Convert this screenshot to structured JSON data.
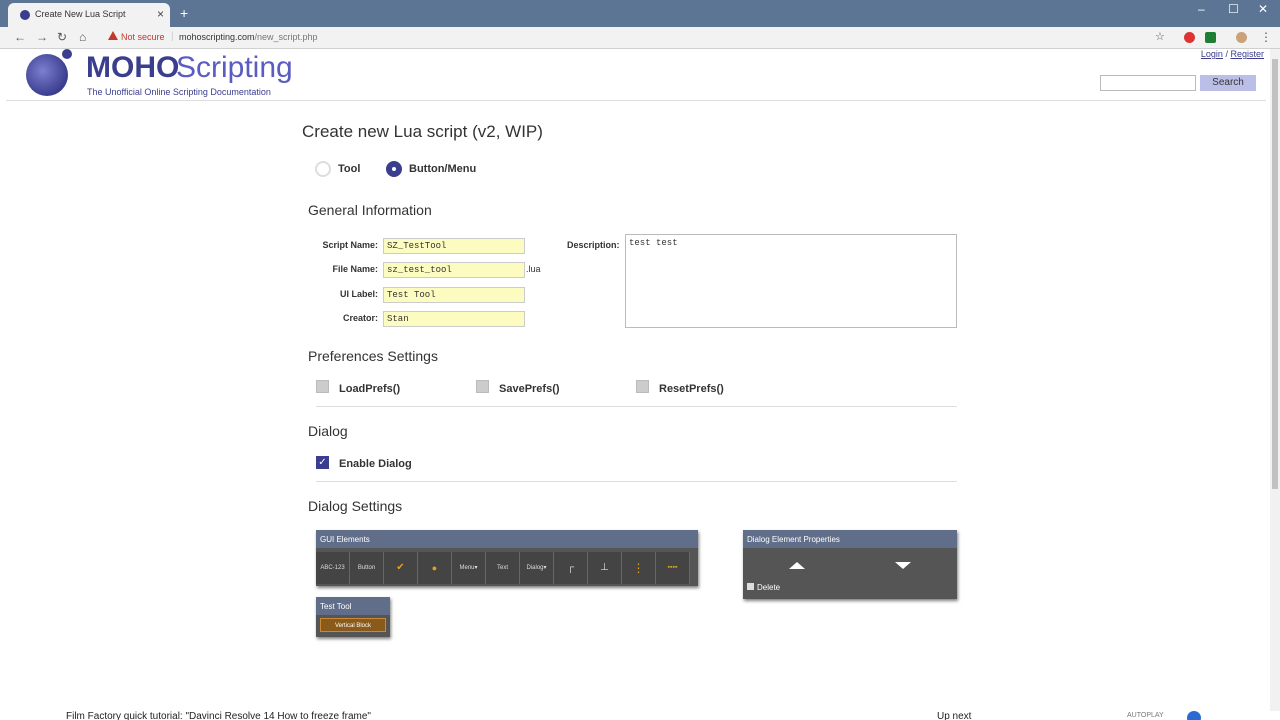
{
  "browser": {
    "tab_title": "Create New Lua Script",
    "address_warning": "Not secure",
    "url_domain": "mohoscripting.com",
    "url_path": "/new_script.php"
  },
  "site": {
    "brand_moho": "MOHO",
    "brand_scripting": "Scripting",
    "tagline": "The Unofficial Online Scripting Documentation",
    "login": "Login",
    "separator": "/",
    "register": "Register",
    "search_label": "Search"
  },
  "page": {
    "title": "Create new Lua script (v2, WIP)",
    "type_tool": "Tool",
    "type_button": "Button/Menu",
    "general_heading": "General Information",
    "fields": {
      "script_name_label": "Script Name:",
      "script_name_value": "SZ_TestTool",
      "file_name_label": "File Name:",
      "file_name_value": "sz_test_tool",
      "file_ext": ".lua",
      "ui_label_label": "UI Label:",
      "ui_label_value": "Test Tool",
      "creator_label": "Creator:",
      "creator_value": "Stan",
      "description_label": "Description:",
      "description_value": "test test"
    },
    "prefs_heading": "Preferences Settings",
    "load_prefs": "LoadPrefs()",
    "save_prefs": "SavePrefs()",
    "reset_prefs": "ResetPrefs()",
    "dialog_heading": "Dialog",
    "enable_dialog": "Enable Dialog",
    "dialog_settings_heading": "Dialog Settings",
    "gui_elements_title": "GUI Elements",
    "gui_elements": [
      "ABC-123",
      "Button",
      "✔",
      "●",
      "Menu▾",
      "Text",
      "Dialog▾",
      "┌",
      "⊥",
      "⋮",
      "▪▪▪▪"
    ],
    "props_title": "Dialog Element Properties",
    "delete_label": "Delete",
    "test_tool_title": "Test Tool",
    "vertical_block": "Vertical Block"
  },
  "footer": {
    "video_title": "Film Factory quick tutorial: \"Davinci Resolve 14 How to freeze frame\"",
    "up_next": "Up next",
    "autoplay": "AUTOPLAY"
  }
}
